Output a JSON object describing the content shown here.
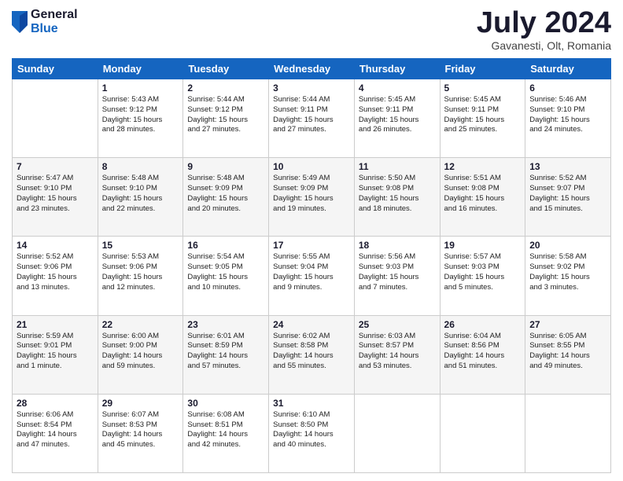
{
  "header": {
    "logo_general": "General",
    "logo_blue": "Blue",
    "month_title": "July 2024",
    "location": "Gavanesti, Olt, Romania"
  },
  "weekdays": [
    "Sunday",
    "Monday",
    "Tuesday",
    "Wednesday",
    "Thursday",
    "Friday",
    "Saturday"
  ],
  "weeks": [
    [
      {
        "day": "",
        "info": ""
      },
      {
        "day": "1",
        "info": "Sunrise: 5:43 AM\nSunset: 9:12 PM\nDaylight: 15 hours\nand 28 minutes."
      },
      {
        "day": "2",
        "info": "Sunrise: 5:44 AM\nSunset: 9:12 PM\nDaylight: 15 hours\nand 27 minutes."
      },
      {
        "day": "3",
        "info": "Sunrise: 5:44 AM\nSunset: 9:11 PM\nDaylight: 15 hours\nand 27 minutes."
      },
      {
        "day": "4",
        "info": "Sunrise: 5:45 AM\nSunset: 9:11 PM\nDaylight: 15 hours\nand 26 minutes."
      },
      {
        "day": "5",
        "info": "Sunrise: 5:45 AM\nSunset: 9:11 PM\nDaylight: 15 hours\nand 25 minutes."
      },
      {
        "day": "6",
        "info": "Sunrise: 5:46 AM\nSunset: 9:10 PM\nDaylight: 15 hours\nand 24 minutes."
      }
    ],
    [
      {
        "day": "7",
        "info": "Sunrise: 5:47 AM\nSunset: 9:10 PM\nDaylight: 15 hours\nand 23 minutes."
      },
      {
        "day": "8",
        "info": "Sunrise: 5:48 AM\nSunset: 9:10 PM\nDaylight: 15 hours\nand 22 minutes."
      },
      {
        "day": "9",
        "info": "Sunrise: 5:48 AM\nSunset: 9:09 PM\nDaylight: 15 hours\nand 20 minutes."
      },
      {
        "day": "10",
        "info": "Sunrise: 5:49 AM\nSunset: 9:09 PM\nDaylight: 15 hours\nand 19 minutes."
      },
      {
        "day": "11",
        "info": "Sunrise: 5:50 AM\nSunset: 9:08 PM\nDaylight: 15 hours\nand 18 minutes."
      },
      {
        "day": "12",
        "info": "Sunrise: 5:51 AM\nSunset: 9:08 PM\nDaylight: 15 hours\nand 16 minutes."
      },
      {
        "day": "13",
        "info": "Sunrise: 5:52 AM\nSunset: 9:07 PM\nDaylight: 15 hours\nand 15 minutes."
      }
    ],
    [
      {
        "day": "14",
        "info": "Sunrise: 5:52 AM\nSunset: 9:06 PM\nDaylight: 15 hours\nand 13 minutes."
      },
      {
        "day": "15",
        "info": "Sunrise: 5:53 AM\nSunset: 9:06 PM\nDaylight: 15 hours\nand 12 minutes."
      },
      {
        "day": "16",
        "info": "Sunrise: 5:54 AM\nSunset: 9:05 PM\nDaylight: 15 hours\nand 10 minutes."
      },
      {
        "day": "17",
        "info": "Sunrise: 5:55 AM\nSunset: 9:04 PM\nDaylight: 15 hours\nand 9 minutes."
      },
      {
        "day": "18",
        "info": "Sunrise: 5:56 AM\nSunset: 9:03 PM\nDaylight: 15 hours\nand 7 minutes."
      },
      {
        "day": "19",
        "info": "Sunrise: 5:57 AM\nSunset: 9:03 PM\nDaylight: 15 hours\nand 5 minutes."
      },
      {
        "day": "20",
        "info": "Sunrise: 5:58 AM\nSunset: 9:02 PM\nDaylight: 15 hours\nand 3 minutes."
      }
    ],
    [
      {
        "day": "21",
        "info": "Sunrise: 5:59 AM\nSunset: 9:01 PM\nDaylight: 15 hours\nand 1 minute."
      },
      {
        "day": "22",
        "info": "Sunrise: 6:00 AM\nSunset: 9:00 PM\nDaylight: 14 hours\nand 59 minutes."
      },
      {
        "day": "23",
        "info": "Sunrise: 6:01 AM\nSunset: 8:59 PM\nDaylight: 14 hours\nand 57 minutes."
      },
      {
        "day": "24",
        "info": "Sunrise: 6:02 AM\nSunset: 8:58 PM\nDaylight: 14 hours\nand 55 minutes."
      },
      {
        "day": "25",
        "info": "Sunrise: 6:03 AM\nSunset: 8:57 PM\nDaylight: 14 hours\nand 53 minutes."
      },
      {
        "day": "26",
        "info": "Sunrise: 6:04 AM\nSunset: 8:56 PM\nDaylight: 14 hours\nand 51 minutes."
      },
      {
        "day": "27",
        "info": "Sunrise: 6:05 AM\nSunset: 8:55 PM\nDaylight: 14 hours\nand 49 minutes."
      }
    ],
    [
      {
        "day": "28",
        "info": "Sunrise: 6:06 AM\nSunset: 8:54 PM\nDaylight: 14 hours\nand 47 minutes."
      },
      {
        "day": "29",
        "info": "Sunrise: 6:07 AM\nSunset: 8:53 PM\nDaylight: 14 hours\nand 45 minutes."
      },
      {
        "day": "30",
        "info": "Sunrise: 6:08 AM\nSunset: 8:51 PM\nDaylight: 14 hours\nand 42 minutes."
      },
      {
        "day": "31",
        "info": "Sunrise: 6:10 AM\nSunset: 8:50 PM\nDaylight: 14 hours\nand 40 minutes."
      },
      {
        "day": "",
        "info": ""
      },
      {
        "day": "",
        "info": ""
      },
      {
        "day": "",
        "info": ""
      }
    ]
  ]
}
